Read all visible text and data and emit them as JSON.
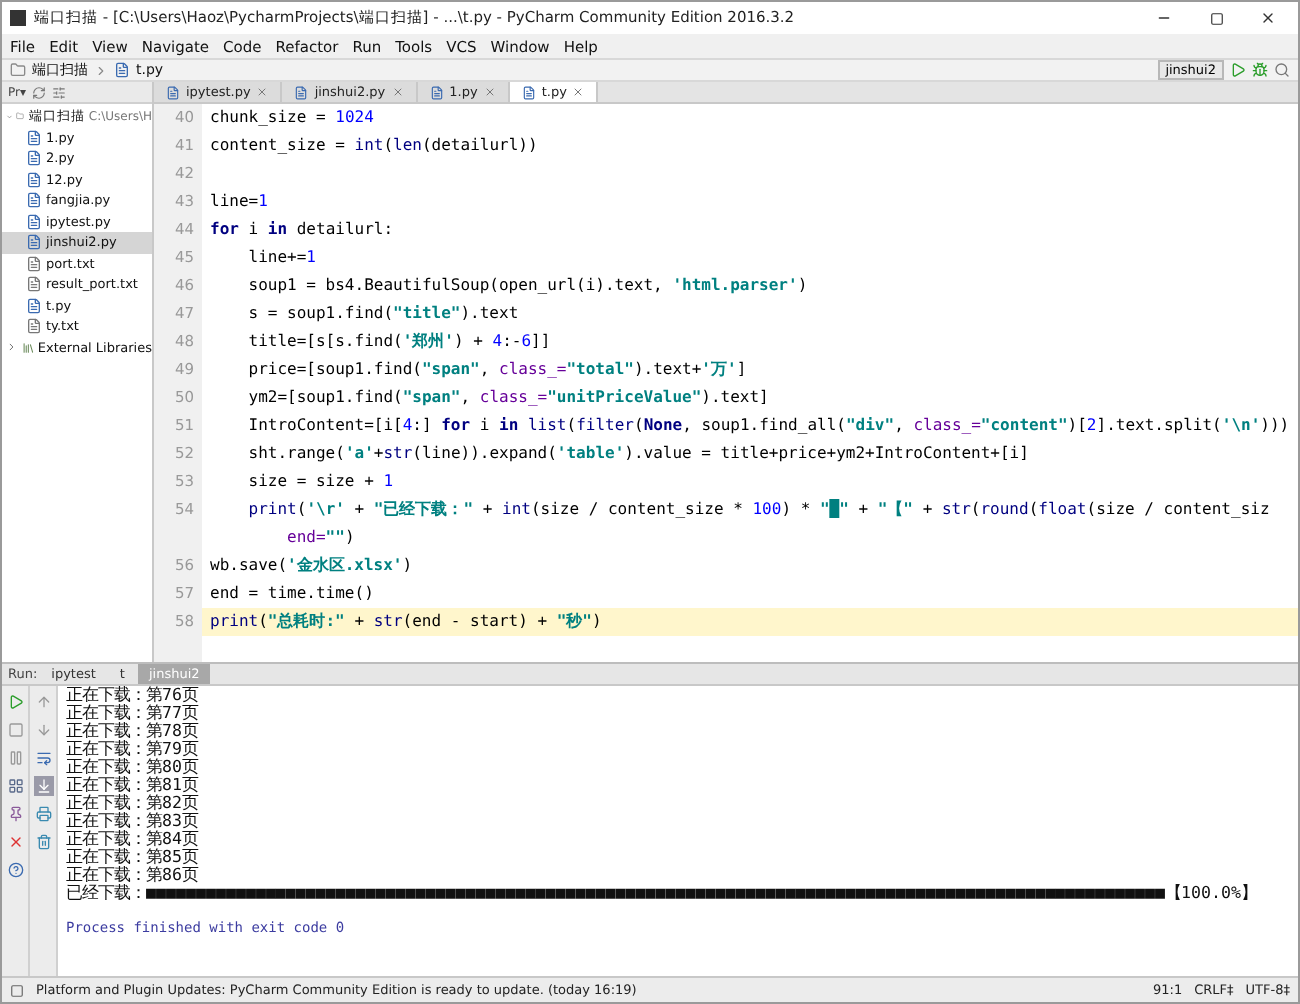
{
  "window": {
    "title": "端口扫描 - [C:\\Users\\Haoz\\PycharmProjects\\端口扫描] - ...\\t.py - PyCharm Community Edition 2016.3.2"
  },
  "menu": [
    "File",
    "Edit",
    "View",
    "Navigate",
    "Code",
    "Refactor",
    "Run",
    "Tools",
    "VCS",
    "Window",
    "Help"
  ],
  "breadcrumbs": [
    "端口扫描",
    "t.py"
  ],
  "run_config": {
    "label": "jinshui2"
  },
  "project_pane": {
    "view_label": "Pr▾"
  },
  "tree": [
    {
      "label": "端口扫描",
      "path": "C:\\Users\\H",
      "kind": "folder",
      "expanded": true,
      "selected": false,
      "children": [
        {
          "label": "1.py",
          "kind": "python",
          "selected": false
        },
        {
          "label": "2.py",
          "kind": "python",
          "selected": false
        },
        {
          "label": "12.py",
          "kind": "python",
          "selected": false
        },
        {
          "label": "fangjia.py",
          "kind": "python",
          "selected": false
        },
        {
          "label": "ipytest.py",
          "kind": "python",
          "selected": false
        },
        {
          "label": "jinshui2.py",
          "kind": "python",
          "selected": true
        },
        {
          "label": "port.txt",
          "kind": "text",
          "selected": false
        },
        {
          "label": "result_port.txt",
          "kind": "text",
          "selected": false
        },
        {
          "label": "t.py",
          "kind": "python",
          "selected": false
        },
        {
          "label": "ty.txt",
          "kind": "text",
          "selected": false
        }
      ]
    },
    {
      "label": "External Libraries",
      "kind": "library",
      "expanded": false,
      "selected": false
    }
  ],
  "editor_tabs": [
    {
      "label": "ipytest.py",
      "selected": false
    },
    {
      "label": "jinshui2.py",
      "selected": false
    },
    {
      "label": "1.py",
      "selected": false
    },
    {
      "label": "t.py",
      "selected": true
    }
  ],
  "code": [
    {
      "number": "40",
      "current": false,
      "segments": [
        {
          "kind": "plain",
          "text": "chunk_size = "
        },
        {
          "kind": "number",
          "text": "1024"
        }
      ]
    },
    {
      "number": "41",
      "current": false,
      "segments": [
        {
          "kind": "plain",
          "text": "content_size = "
        },
        {
          "kind": "builtin",
          "text": "int"
        },
        {
          "kind": "plain",
          "text": "("
        },
        {
          "kind": "builtin",
          "text": "len"
        },
        {
          "kind": "plain",
          "text": "(detailurl))"
        }
      ]
    },
    {
      "number": "42",
      "current": false
    },
    {
      "number": "43",
      "current": false,
      "segments": [
        {
          "kind": "plain",
          "text": "line="
        },
        {
          "kind": "number",
          "text": "1"
        }
      ]
    },
    {
      "number": "44",
      "current": false,
      "segments": [
        {
          "kind": "keyword",
          "text": "for"
        },
        {
          "kind": "plain",
          "text": " i "
        },
        {
          "kind": "keyword",
          "text": "in"
        },
        {
          "kind": "plain",
          "text": " detailurl:"
        }
      ]
    },
    {
      "number": "45",
      "current": false,
      "segments": [
        {
          "kind": "plain",
          "text": "    line+="
        },
        {
          "kind": "number",
          "text": "1"
        }
      ]
    },
    {
      "number": "46",
      "current": false,
      "segments": [
        {
          "kind": "plain",
          "text": "    soup1 = bs4.BeautifulSoup(open_url(i).text, "
        },
        {
          "kind": "string",
          "text": "'html.parser'"
        },
        {
          "kind": "plain",
          "text": ")"
        }
      ]
    },
    {
      "number": "47",
      "current": false,
      "segments": [
        {
          "kind": "plain",
          "text": "    s = soup1.find("
        },
        {
          "kind": "string",
          "text": "\"title\""
        },
        {
          "kind": "plain",
          "text": ").text"
        }
      ]
    },
    {
      "number": "48",
      "current": false,
      "segments": [
        {
          "kind": "plain",
          "text": "    title=[s[s.find("
        },
        {
          "kind": "string",
          "text": "'郑州'"
        },
        {
          "kind": "plain",
          "text": ") + "
        },
        {
          "kind": "number",
          "text": "4"
        },
        {
          "kind": "plain",
          "text": ":-"
        },
        {
          "kind": "number",
          "text": "6"
        },
        {
          "kind": "plain",
          "text": "]]"
        }
      ]
    },
    {
      "number": "49",
      "current": false,
      "segments": [
        {
          "kind": "plain",
          "text": "    price=[soup1.find("
        },
        {
          "kind": "string",
          "text": "\"span\""
        },
        {
          "kind": "plain",
          "text": ", "
        },
        {
          "kind": "param",
          "text": "class_="
        },
        {
          "kind": "string",
          "text": "\"total\""
        },
        {
          "kind": "plain",
          "text": ").text+"
        },
        {
          "kind": "string",
          "text": "'万'"
        },
        {
          "kind": "plain",
          "text": "]"
        }
      ]
    },
    {
      "number": "50",
      "current": false,
      "segments": [
        {
          "kind": "plain",
          "text": "    ym2=[soup1.find("
        },
        {
          "kind": "string",
          "text": "\"span\""
        },
        {
          "kind": "plain",
          "text": ", "
        },
        {
          "kind": "param",
          "text": "class_="
        },
        {
          "kind": "string",
          "text": "\"unitPriceValue\""
        },
        {
          "kind": "plain",
          "text": ").text]"
        }
      ]
    },
    {
      "number": "51",
      "current": false,
      "segments": [
        {
          "kind": "plain",
          "text": "    IntroContent=[i["
        },
        {
          "kind": "number",
          "text": "4"
        },
        {
          "kind": "plain",
          "text": ":] "
        },
        {
          "kind": "keyword",
          "text": "for"
        },
        {
          "kind": "plain",
          "text": " i "
        },
        {
          "kind": "keyword",
          "text": "in"
        },
        {
          "kind": "builtin",
          "text": " list"
        },
        {
          "kind": "plain",
          "text": "("
        },
        {
          "kind": "builtin",
          "text": "filter"
        },
        {
          "kind": "plain",
          "text": "("
        },
        {
          "kind": "keyword",
          "text": "None"
        },
        {
          "kind": "plain",
          "text": ", soup1.find_all("
        },
        {
          "kind": "string",
          "text": "\"div\""
        },
        {
          "kind": "plain",
          "text": ", "
        },
        {
          "kind": "param",
          "text": "class_="
        },
        {
          "kind": "string",
          "text": "\"content\""
        },
        {
          "kind": "plain",
          "text": ")["
        },
        {
          "kind": "number",
          "text": "2"
        },
        {
          "kind": "plain",
          "text": "].text.split("
        },
        {
          "kind": "string",
          "text": "'\\n'"
        },
        {
          "kind": "plain",
          "text": ")))"
        }
      ]
    },
    {
      "number": "52",
      "current": false,
      "segments": [
        {
          "kind": "plain",
          "text": "    sht.range("
        },
        {
          "kind": "string",
          "text": "'a'"
        },
        {
          "kind": "plain",
          "text": "+"
        },
        {
          "kind": "builtin",
          "text": "str"
        },
        {
          "kind": "plain",
          "text": "(line)).expand("
        },
        {
          "kind": "string",
          "text": "'table'"
        },
        {
          "kind": "plain",
          "text": ").value = title+price+ym2+IntroContent+[i]"
        }
      ]
    },
    {
      "number": "53",
      "current": false,
      "segments": [
        {
          "kind": "plain",
          "text": "    size = size + "
        },
        {
          "kind": "number",
          "text": "1"
        }
      ]
    },
    {
      "number": "54",
      "current": false,
      "segments": [
        {
          "kind": "builtin",
          "text": "    print"
        },
        {
          "kind": "plain",
          "text": "("
        },
        {
          "kind": "string",
          "text": "'\\r'"
        },
        {
          "kind": "plain",
          "text": " + "
        },
        {
          "kind": "string",
          "text": "\"已经下载：\""
        },
        {
          "kind": "plain",
          "text": " + "
        },
        {
          "kind": "builtin",
          "text": "int"
        },
        {
          "kind": "plain",
          "text": "(size / content_size * "
        },
        {
          "kind": "number",
          "text": "100"
        },
        {
          "kind": "plain",
          "text": ") * "
        },
        {
          "kind": "string",
          "text": "\"█\""
        },
        {
          "kind": "plain",
          "text": " + "
        },
        {
          "kind": "string",
          "text": "\"【\""
        },
        {
          "kind": "plain",
          "text": " + "
        },
        {
          "kind": "builtin",
          "text": "str"
        },
        {
          "kind": "plain",
          "text": "("
        },
        {
          "kind": "builtin",
          "text": "round"
        },
        {
          "kind": "plain",
          "text": "("
        },
        {
          "kind": "builtin",
          "text": "float"
        },
        {
          "kind": "plain",
          "text": "(size / content_siz"
        }
      ]
    },
    {
      "current": false,
      "segments": [
        {
          "kind": "param",
          "text": "        end="
        },
        {
          "kind": "string",
          "text": "\"\""
        },
        {
          "kind": "plain",
          "text": ")"
        }
      ]
    },
    {
      "number": "56",
      "current": false,
      "segments": [
        {
          "kind": "plain",
          "text": "wb.save("
        },
        {
          "kind": "string",
          "text": "'金水区.xlsx'"
        },
        {
          "kind": "plain",
          "text": ")"
        }
      ]
    },
    {
      "number": "57",
      "current": false,
      "segments": [
        {
          "kind": "plain",
          "text": "end = time.time()"
        }
      ]
    },
    {
      "number": "58",
      "current": true,
      "segments": [
        {
          "kind": "builtin",
          "text": "print"
        },
        {
          "kind": "plain",
          "text": "("
        },
        {
          "kind": "string",
          "text": "\"总耗时:\""
        },
        {
          "kind": "plain",
          "text": " + "
        },
        {
          "kind": "builtin",
          "text": "str"
        },
        {
          "kind": "plain",
          "text": "(end - start) + "
        },
        {
          "kind": "string",
          "text": "\"秒\""
        },
        {
          "kind": "plain",
          "text": ")"
        }
      ]
    }
  ],
  "run_panel": {
    "label": "Run:",
    "tabs": [
      {
        "label": "ipytest",
        "selected": false
      },
      {
        "label": "t",
        "selected": false
      },
      {
        "label": "jinshui2",
        "selected": true
      }
    ],
    "actions": [
      {
        "kind": "run"
      },
      {
        "kind": "stop"
      },
      {
        "kind": "pause"
      },
      {
        "kind": "layout"
      },
      {
        "kind": "pin"
      },
      {
        "kind": "close"
      },
      {
        "kind": "help"
      }
    ],
    "console_tools": [
      {
        "kind": "up",
        "on": false
      },
      {
        "kind": "down",
        "on": false
      },
      {
        "kind": "wrap",
        "on": false
      },
      {
        "kind": "scroll",
        "on": true
      },
      {
        "kind": "print",
        "on": false
      },
      {
        "kind": "trash",
        "on": false
      }
    ],
    "output": [
      {
        "kind": "text",
        "text": "正在下载：第76页"
      },
      {
        "kind": "text",
        "text": "正在下载：第77页"
      },
      {
        "kind": "text",
        "text": "正在下载：第78页"
      },
      {
        "kind": "text",
        "text": "正在下载：第79页"
      },
      {
        "kind": "text",
        "text": "正在下载：第80页"
      },
      {
        "kind": "text",
        "text": "正在下载：第81页"
      },
      {
        "kind": "text",
        "text": "正在下载：第82页"
      },
      {
        "kind": "text",
        "text": "正在下载：第83页"
      },
      {
        "kind": "text",
        "text": "正在下载：第84页"
      },
      {
        "kind": "text",
        "text": "正在下载：第85页"
      },
      {
        "kind": "text",
        "text": "正在下载：第86页"
      },
      {
        "kind": "text",
        "text": "已经下载：■■■■■■■■■■■■■■■■■■■■■■■■■■■■■■■■■■■■■■■■■■■■■■■■■■■■■■■■■■■■■■■■■■■■■■■■■■■■■■■■■■■■■■■■■■■■■■■■■■■■■■【100.0%】"
      },
      {
        "kind": "gap"
      },
      {
        "kind": "system",
        "text": "Process finished with exit code 0"
      }
    ]
  },
  "status_bar": {
    "message": "Platform and Plugin Updates: PyCharm Community Edition is ready to update. (today 16:19)",
    "position": "91:1",
    "line_separator": "CRLF‡",
    "encoding": "UTF-8‡"
  }
}
